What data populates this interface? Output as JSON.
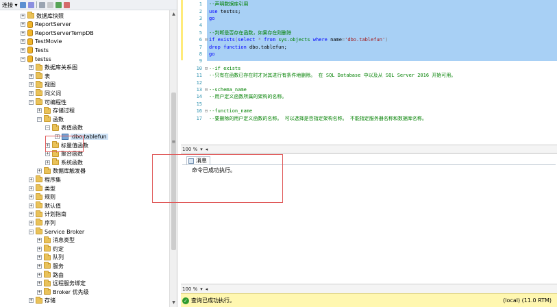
{
  "explorer": {
    "toolbar": {
      "connect_label": "连接 ▾"
    },
    "tree": [
      {
        "label": "数据库快照",
        "icon": "folder-icon",
        "exp": "⊞"
      },
      {
        "label": "ReportServer",
        "icon": "database-icon",
        "exp": "⊞"
      },
      {
        "label": "ReportServerTempDB",
        "icon": "database-icon",
        "exp": "⊞"
      },
      {
        "label": "TestMovie",
        "icon": "database-icon",
        "exp": "⊞"
      },
      {
        "label": "Tests",
        "icon": "database-icon",
        "exp": "⊞"
      },
      {
        "label": "testss",
        "icon": "database-icon",
        "exp": "⊟"
      },
      {
        "label": "数据库关系图",
        "icon": "folder-icon",
        "exp": "⊞"
      },
      {
        "label": "表",
        "icon": "folder-icon",
        "exp": "⊞"
      },
      {
        "label": "视图",
        "icon": "folder-icon",
        "exp": "⊞"
      },
      {
        "label": "同义词",
        "icon": "folder-icon",
        "exp": "⊞"
      },
      {
        "label": "可编程性",
        "icon": "folder-icon",
        "exp": "⊟"
      },
      {
        "label": "存储过程",
        "icon": "folder-icon",
        "exp": "⊞"
      },
      {
        "label": "函数",
        "icon": "folder-icon",
        "exp": "⊟"
      },
      {
        "label": "表值函数",
        "icon": "folder-icon",
        "exp": "⊟"
      },
      {
        "label": "dbo.tablefun",
        "icon": "function-icon",
        "exp": "⊞"
      },
      {
        "label": "标量值函数",
        "icon": "folder-icon",
        "exp": "⊞"
      },
      {
        "label": "聚合函数",
        "icon": "folder-icon",
        "exp": "⊞"
      },
      {
        "label": "系统函数",
        "icon": "folder-icon",
        "exp": "⊞"
      },
      {
        "label": "数据库触发器",
        "icon": "folder-icon",
        "exp": "⊞"
      },
      {
        "label": "程序集",
        "icon": "folder-icon",
        "exp": "⊞"
      },
      {
        "label": "类型",
        "icon": "folder-icon",
        "exp": "⊞"
      },
      {
        "label": "规则",
        "icon": "folder-icon",
        "exp": "⊞"
      },
      {
        "label": "默认值",
        "icon": "folder-icon",
        "exp": "⊞"
      },
      {
        "label": "计划指南",
        "icon": "folder-icon",
        "exp": "⊞"
      },
      {
        "label": "序列",
        "icon": "folder-icon",
        "exp": "⊞"
      },
      {
        "label": "Service Broker",
        "icon": "folder-icon",
        "exp": "⊟"
      },
      {
        "label": "消息类型",
        "icon": "folder-icon",
        "exp": "⊞"
      },
      {
        "label": "约定",
        "icon": "folder-icon",
        "exp": "⊞"
      },
      {
        "label": "队列",
        "icon": "folder-icon",
        "exp": "⊞"
      },
      {
        "label": "服务",
        "icon": "folder-icon",
        "exp": "⊞"
      },
      {
        "label": "路由",
        "icon": "folder-icon",
        "exp": "⊞"
      },
      {
        "label": "远程服务绑定",
        "icon": "folder-icon",
        "exp": "⊞"
      },
      {
        "label": "Broker 优先级",
        "icon": "folder-icon",
        "exp": "⊞"
      },
      {
        "label": "存储",
        "icon": "folder-icon",
        "exp": "⊞"
      }
    ]
  },
  "editor": {
    "lines": [
      {
        "no": "1",
        "fold": "",
        "parts": [
          [
            "c-green",
            "--声明数据库引用"
          ]
        ]
      },
      {
        "no": "2",
        "fold": "",
        "parts": [
          [
            "c-blue",
            "use"
          ],
          [
            "c-black",
            " testss;"
          ]
        ]
      },
      {
        "no": "3",
        "fold": "",
        "parts": [
          [
            "c-blue",
            "go"
          ]
        ]
      },
      {
        "no": "4",
        "fold": "",
        "parts": []
      },
      {
        "no": "5",
        "fold": "",
        "parts": [
          [
            "c-green",
            "--判断是否存在函数，如果存在则删除"
          ]
        ]
      },
      {
        "no": "6",
        "fold": "⊟",
        "parts": [
          [
            "c-blue",
            "if"
          ],
          [
            "c-black",
            " "
          ],
          [
            "c-blue",
            "exists"
          ],
          [
            "c-gray",
            "("
          ],
          [
            "c-blue",
            "select"
          ],
          [
            "c-black",
            " "
          ],
          [
            "c-gray",
            "*"
          ],
          [
            "c-black",
            " "
          ],
          [
            "c-blue",
            "from"
          ],
          [
            "c-black",
            " "
          ],
          [
            "c-green",
            "sys.objects"
          ],
          [
            "c-black",
            " "
          ],
          [
            "c-blue",
            "where"
          ],
          [
            "c-black",
            " name"
          ],
          [
            "c-gray",
            "="
          ],
          [
            "c-red",
            "'dbo.tablefun'"
          ],
          [
            "c-gray",
            ")"
          ]
        ]
      },
      {
        "no": "7",
        "fold": "",
        "parts": [
          [
            "c-blue",
            "drop"
          ],
          [
            "c-black",
            " "
          ],
          [
            "c-blue",
            "function"
          ],
          [
            "c-black",
            " dbo.tablefun;"
          ]
        ]
      },
      {
        "no": "8",
        "fold": "",
        "parts": [
          [
            "c-blue",
            "go"
          ]
        ]
      },
      {
        "no": "9",
        "fold": "",
        "parts": []
      },
      {
        "no": "10",
        "fold": "⊟",
        "parts": [
          [
            "c-green",
            "--if exists"
          ]
        ]
      },
      {
        "no": "11",
        "fold": "",
        "parts": [
          [
            "c-green",
            "--只有在函数已存在时才对其进行有条件地删除。 在 SQL Database 中以及从 SQL Server 2016 开始可用。"
          ]
        ]
      },
      {
        "no": "12",
        "fold": "",
        "parts": []
      },
      {
        "no": "13",
        "fold": "⊟",
        "parts": [
          [
            "c-green",
            "--schema_name"
          ]
        ]
      },
      {
        "no": "14",
        "fold": "",
        "parts": [
          [
            "c-green",
            "--用户定义函数所属的架构的名称。"
          ]
        ]
      },
      {
        "no": "15",
        "fold": "",
        "parts": []
      },
      {
        "no": "16",
        "fold": "⊟",
        "parts": [
          [
            "c-green",
            "--function_name"
          ]
        ]
      },
      {
        "no": "17",
        "fold": "",
        "parts": [
          [
            "c-green",
            "--要删除的用户定义函数的名称。 可以选择是否指定架构名称。 不能指定服务器名称和数据库名称。"
          ]
        ]
      }
    ]
  },
  "zoom_top": "100 %",
  "zoom_bottom": "100 %",
  "results": {
    "tab_label": "消息",
    "message": "命令已成功执行。"
  },
  "status": {
    "left": "查询已成功执行。",
    "right": "(local) (11.0 RTM)"
  }
}
